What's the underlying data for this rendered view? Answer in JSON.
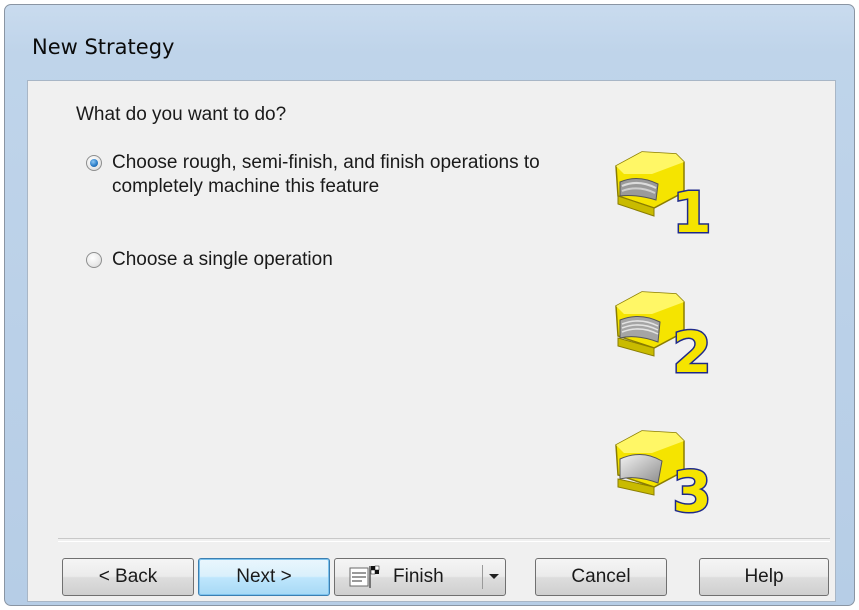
{
  "window": {
    "title": "New Strategy"
  },
  "prompt": "What do you want to do?",
  "options": [
    {
      "label": "Choose rough, semi-finish, and finish operations to completely machine this feature",
      "checked": true
    },
    {
      "label": "Choose a single operation",
      "checked": false
    }
  ],
  "stage_icons": [
    "stage-1-icon",
    "stage-2-icon",
    "stage-3-icon"
  ],
  "stage_numbers": [
    "1",
    "2",
    "3"
  ],
  "buttons": {
    "back": "< Back",
    "next": "Next >",
    "finish": "Finish",
    "cancel": "Cancel",
    "help": "Help"
  },
  "colors": {
    "accent": "#2d7fc9",
    "icon_yellow": "#f5e400",
    "icon_outline": "#1f2a8a"
  }
}
